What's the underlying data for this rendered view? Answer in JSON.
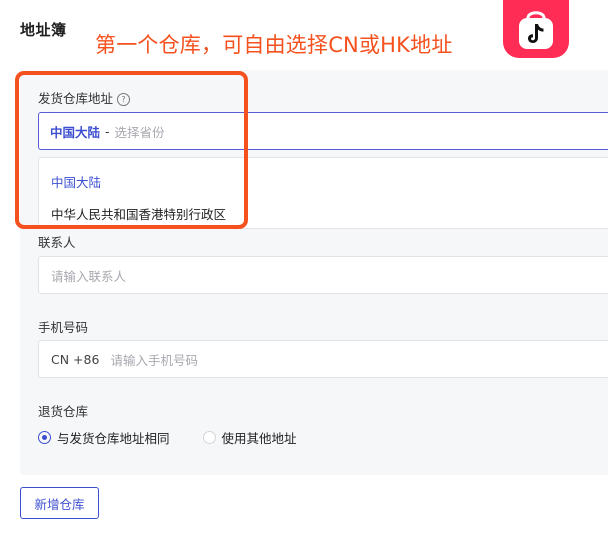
{
  "page": {
    "title": "地址簿"
  },
  "annotation": {
    "text": "第一个仓库，可自由选择CN或HK地址",
    "color": "#f4511e"
  },
  "logo": {
    "icon": "tiktok-shop-bag-icon",
    "color": "#ff2d55"
  },
  "ship_warehouse": {
    "label": "发货仓库地址",
    "help_icon": "?",
    "selected": "中国大陆",
    "separator": "-",
    "placeholder": "选择省份",
    "options": [
      {
        "label": "中国大陆",
        "active": true
      },
      {
        "label": "中华人民共和国香港特别行政区",
        "active": false
      }
    ]
  },
  "contact": {
    "label": "联系人",
    "placeholder": "请输入联系人"
  },
  "phone": {
    "label": "手机号码",
    "prefix": "CN +86",
    "placeholder": "请输入手机号码"
  },
  "return_warehouse": {
    "label": "退货仓库",
    "options": [
      {
        "label": "与发货仓库地址相同",
        "checked": true
      },
      {
        "label": "使用其他地址",
        "checked": false
      }
    ]
  },
  "actions": {
    "add_warehouse_label": "新增仓库"
  },
  "colors": {
    "accent": "#3d4fd1",
    "highlight": "#f4511e",
    "panel_bg": "#f6f7f9"
  }
}
